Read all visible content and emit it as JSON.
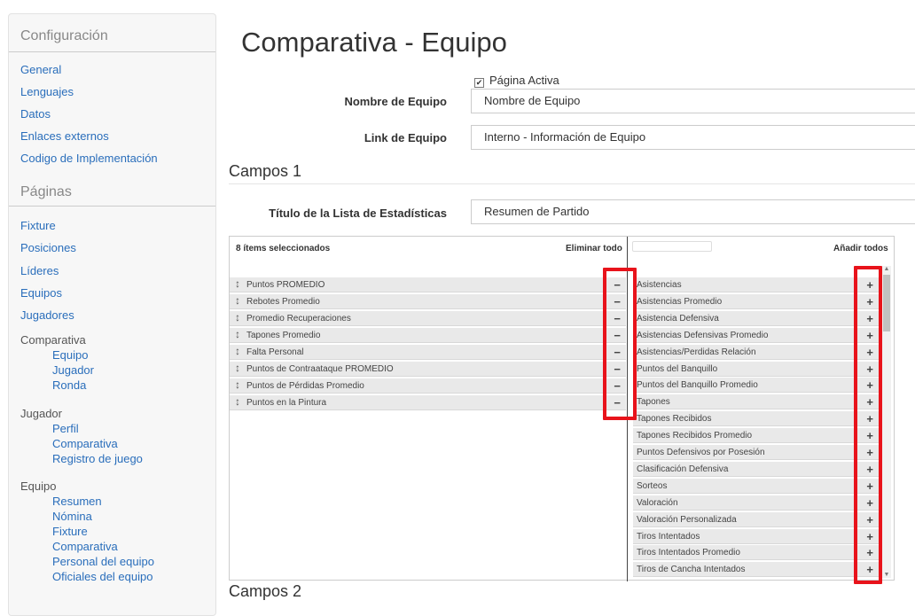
{
  "sidebar": {
    "config_heading": "Configuración",
    "config_links": [
      "General",
      "Lenguajes",
      "Datos",
      "Enlaces externos",
      "Codigo de Implementación"
    ],
    "pages_heading": "Páginas",
    "page_links": [
      "Fixture",
      "Posiciones",
      "Líderes",
      "Equipos",
      "Jugadores"
    ],
    "groups": [
      {
        "label": "Comparativa",
        "items": [
          "Equipo",
          "Jugador",
          "Ronda"
        ]
      },
      {
        "label": "Jugador",
        "items": [
          "Perfil",
          "Comparativa",
          "Registro de juego"
        ]
      },
      {
        "label": "Equipo",
        "items": [
          "Resumen",
          "Nómina",
          "Fixture",
          "Comparativa",
          "Personal del equipo",
          "Oficiales del equipo"
        ]
      }
    ]
  },
  "page": {
    "title": "Comparativa - Equipo",
    "active_label": "Página Activa",
    "team_name_label": "Nombre de Equipo",
    "team_name_value": "Nombre de Equipo",
    "team_link_label": "Link de Equipo",
    "team_link_value": "Interno - Información de Equipo",
    "section1": "Campos 1",
    "stats_title_label": "Título de la Lista de Estadísticas",
    "stats_title_value": "Resumen de Partido",
    "section2": "Campos 2"
  },
  "multiselect": {
    "selected_count": "8 ítems seleccionados",
    "remove_all": "Eliminar todo",
    "add_all": "Añadir todos",
    "selected": [
      "Puntos PROMEDIO",
      "Rebotes Promedio",
      "Promedio Recuperaciones",
      "Tapones Promedio",
      "Falta Personal",
      "Puntos de Contraataque PROMEDIO",
      "Puntos de Pérdidas Promedio",
      "Puntos en la Pintura"
    ],
    "available": [
      "Asistencias",
      "Asistencias Promedio",
      "Asistencia Defensiva",
      "Asistencias Defensivas Promedio",
      "Asistencias/Perdidas Relación",
      "Puntos del Banquillo",
      "Puntos del Banquillo Promedio",
      "Tapones",
      "Tapones Recibidos",
      "Tapones Recibidos Promedio",
      "Puntos Defensivos por Posesión",
      "Clasificación Defensiva",
      "Sorteos",
      "Valoración",
      "Valoración Personalizada",
      "Tiros Intentados",
      "Tiros Intentados Promedio",
      "Tiros de Cancha Intentados"
    ],
    "remove_glyph": "−",
    "add_glyph": "+",
    "grip_glyph": "↕"
  },
  "colors": {
    "link": "#2a6ebb",
    "highlight": "#e8131b"
  }
}
